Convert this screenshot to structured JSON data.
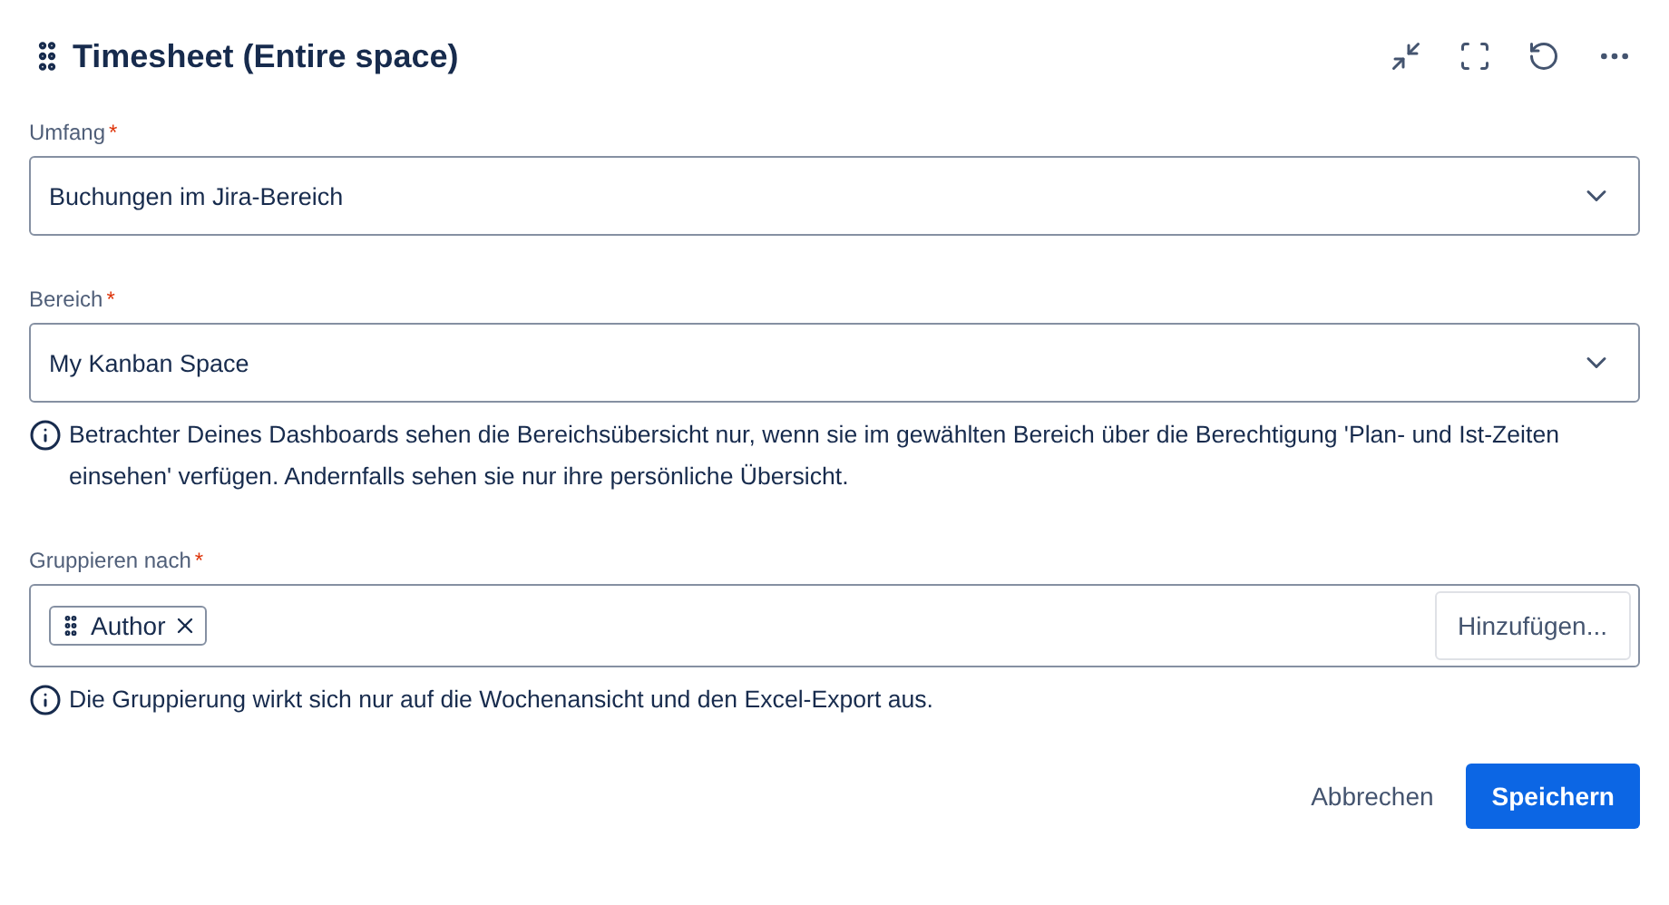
{
  "header": {
    "title": "Timesheet (Entire space)"
  },
  "fields": [
    {
      "kind": "select",
      "label": "Umfang",
      "required_mark": "*",
      "value": "Buchungen im Jira-Bereich"
    },
    {
      "kind": "select",
      "label": "Bereich",
      "required_mark": "*",
      "value": "My Kanban Space",
      "info": "Betrachter Deines Dashboards sehen die Bereichsübersicht nur, wenn sie im gewählten Bereich über die Berechtigung 'Plan- und Ist-Zeiten einsehen' verfügen. Andernfalls sehen sie nur ihre persönliche Übersicht."
    },
    {
      "kind": "tags",
      "label": "Gruppieren nach",
      "required_mark": "*",
      "tags": [
        "Author"
      ],
      "add_button": "Hinzufügen...",
      "info": "Die Gruppierung wirkt sich nur auf die Wochenansicht und den Excel-Export aus."
    }
  ],
  "actions": {
    "cancel": "Abbrechen",
    "save": "Speichern"
  }
}
